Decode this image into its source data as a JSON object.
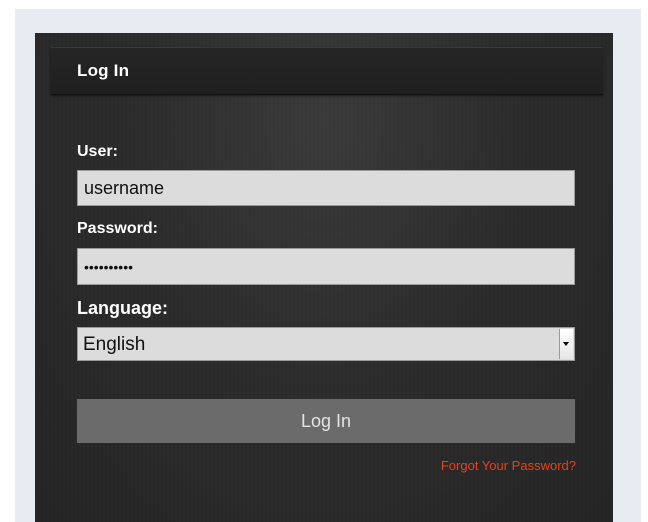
{
  "panel": {
    "title": "Log In"
  },
  "form": {
    "user_label": "User:",
    "user_value": "username",
    "password_label": "Password:",
    "password_value": "••••••••••",
    "language_label": "Language:",
    "language_selected": "English",
    "submit_label": "Log In",
    "forgot_label": "Forgot Your Password?"
  },
  "icons": {
    "select_arrow": "chevron-down-icon"
  },
  "colors": {
    "page_background": "#e7ebf2",
    "panel_background": "#2c2c2c",
    "button_background": "#6b6b6b",
    "link_color": "#e5431a",
    "input_background": "#dcdcdc"
  }
}
